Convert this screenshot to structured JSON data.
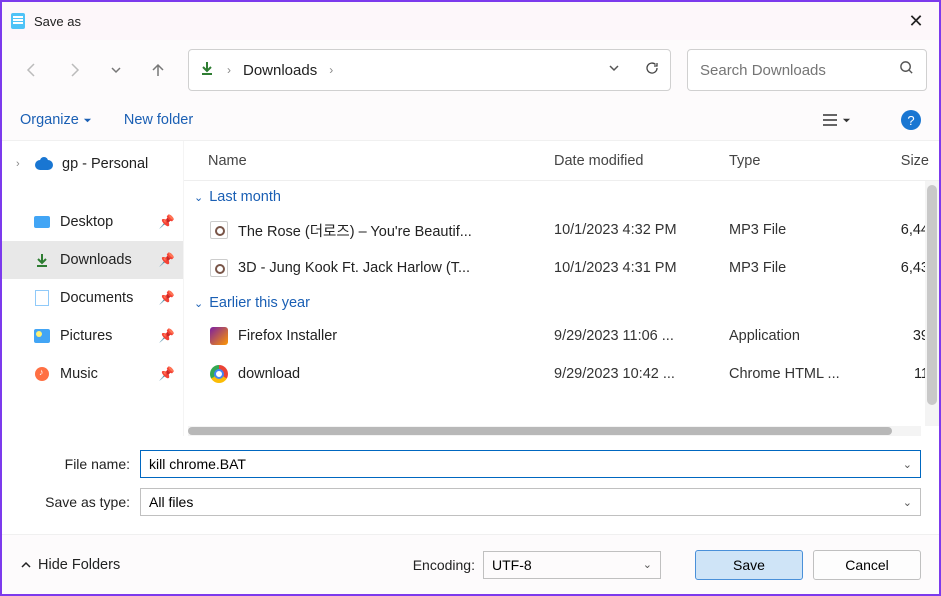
{
  "window": {
    "title": "Save as"
  },
  "nav": {
    "current": "Downloads"
  },
  "search": {
    "placeholder": "Search Downloads"
  },
  "toolbar": {
    "organize": "Organize",
    "newfolder": "New folder",
    "help": "?"
  },
  "sidebar": {
    "root": "gp - Personal",
    "items": [
      {
        "label": "Desktop",
        "icon": "desktop",
        "pinned": true
      },
      {
        "label": "Downloads",
        "icon": "download",
        "pinned": true,
        "selected": true
      },
      {
        "label": "Documents",
        "icon": "docs",
        "pinned": true
      },
      {
        "label": "Pictures",
        "icon": "pics",
        "pinned": true
      },
      {
        "label": "Music",
        "icon": "music",
        "pinned": true
      }
    ]
  },
  "columns": {
    "name": "Name",
    "date": "Date modified",
    "type": "Type",
    "size": "Size"
  },
  "groups": [
    {
      "label": "Last month",
      "files": [
        {
          "name": "The Rose (더로즈) – You're Beautif...",
          "date": "10/1/2023 4:32 PM",
          "type": "MP3 File",
          "size": "6,44",
          "icon": "mp3"
        },
        {
          "name": "3D - Jung Kook Ft. Jack Harlow (T...",
          "date": "10/1/2023 4:31 PM",
          "type": "MP3 File",
          "size": "6,43",
          "icon": "mp3"
        }
      ]
    },
    {
      "label": "Earlier this year",
      "files": [
        {
          "name": "Firefox Installer",
          "date": "9/29/2023 11:06 ...",
          "type": "Application",
          "size": "39",
          "icon": "ff"
        },
        {
          "name": "download",
          "date": "9/29/2023 10:42 ...",
          "type": "Chrome HTML ...",
          "size": "11",
          "icon": "chrome"
        }
      ]
    }
  ],
  "fields": {
    "filename_label": "File name:",
    "filename_value": "kill chrome.BAT",
    "saveastype_label": "Save as type:",
    "saveastype_value": "All files"
  },
  "footer": {
    "hide_folders": "Hide Folders",
    "encoding_label": "Encoding:",
    "encoding_value": "UTF-8",
    "save": "Save",
    "cancel": "Cancel"
  }
}
